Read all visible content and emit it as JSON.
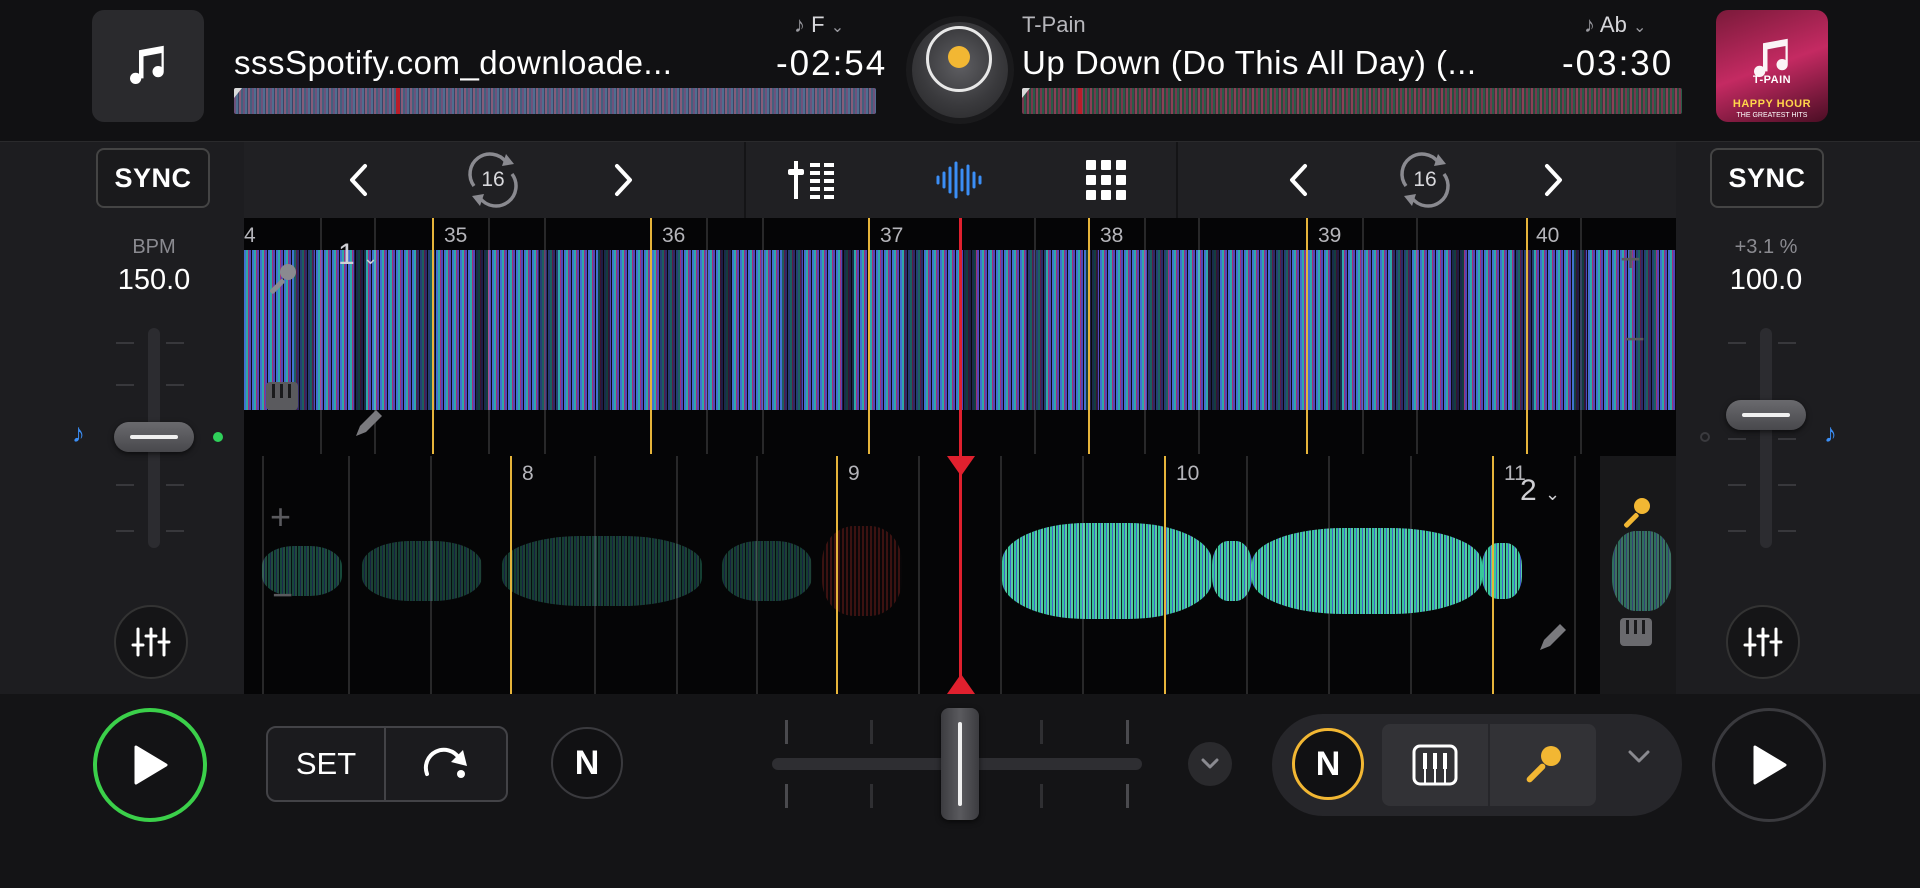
{
  "deck_a": {
    "title": "sssSpotify.com_downloade...",
    "key": "F",
    "time": "-02:54",
    "sync_label": "SYNC",
    "bpm_label": "BPM",
    "bpm_value": "150.0",
    "loop_beats": "16",
    "deck_number": "1",
    "bar_numbers": [
      "4",
      "35",
      "36",
      "37",
      "38",
      "39",
      "40"
    ]
  },
  "deck_b": {
    "artist": "T-Pain",
    "title": "Up Down (Do This All Day) (...",
    "key": "Ab",
    "time": "-03:30",
    "sync_label": "SYNC",
    "pitch_label": "+3.1 %",
    "bpm_value": "100.0",
    "loop_beats": "16",
    "deck_number": "2",
    "bar_numbers": [
      "8",
      "9",
      "10",
      "11"
    ],
    "album_art_caption": "T-PAIN",
    "album_art_title": "HAPPY HOUR",
    "album_art_sub": "THE GREATEST HITS"
  },
  "transport": {
    "set_label": "SET",
    "n_label": "N"
  },
  "colors": {
    "accent_yellow": "#f2b733",
    "play_green": "#3bd04a",
    "playhead_red": "#e0202e",
    "sync_blue": "#3b8ef5"
  },
  "icons": {
    "album_placeholder": "music-note-icon",
    "prev": "chevron-left-icon",
    "next": "chevron-right-icon",
    "loop": "loop-icon",
    "mixer": "mixer-icon",
    "waveform": "waveform-icon",
    "pads": "grid-icon",
    "eq": "sliders-icon",
    "play": "play-icon",
    "jump": "jump-icon",
    "piano": "piano-icon",
    "mic": "microphone-icon",
    "pencil": "pencil-icon"
  }
}
